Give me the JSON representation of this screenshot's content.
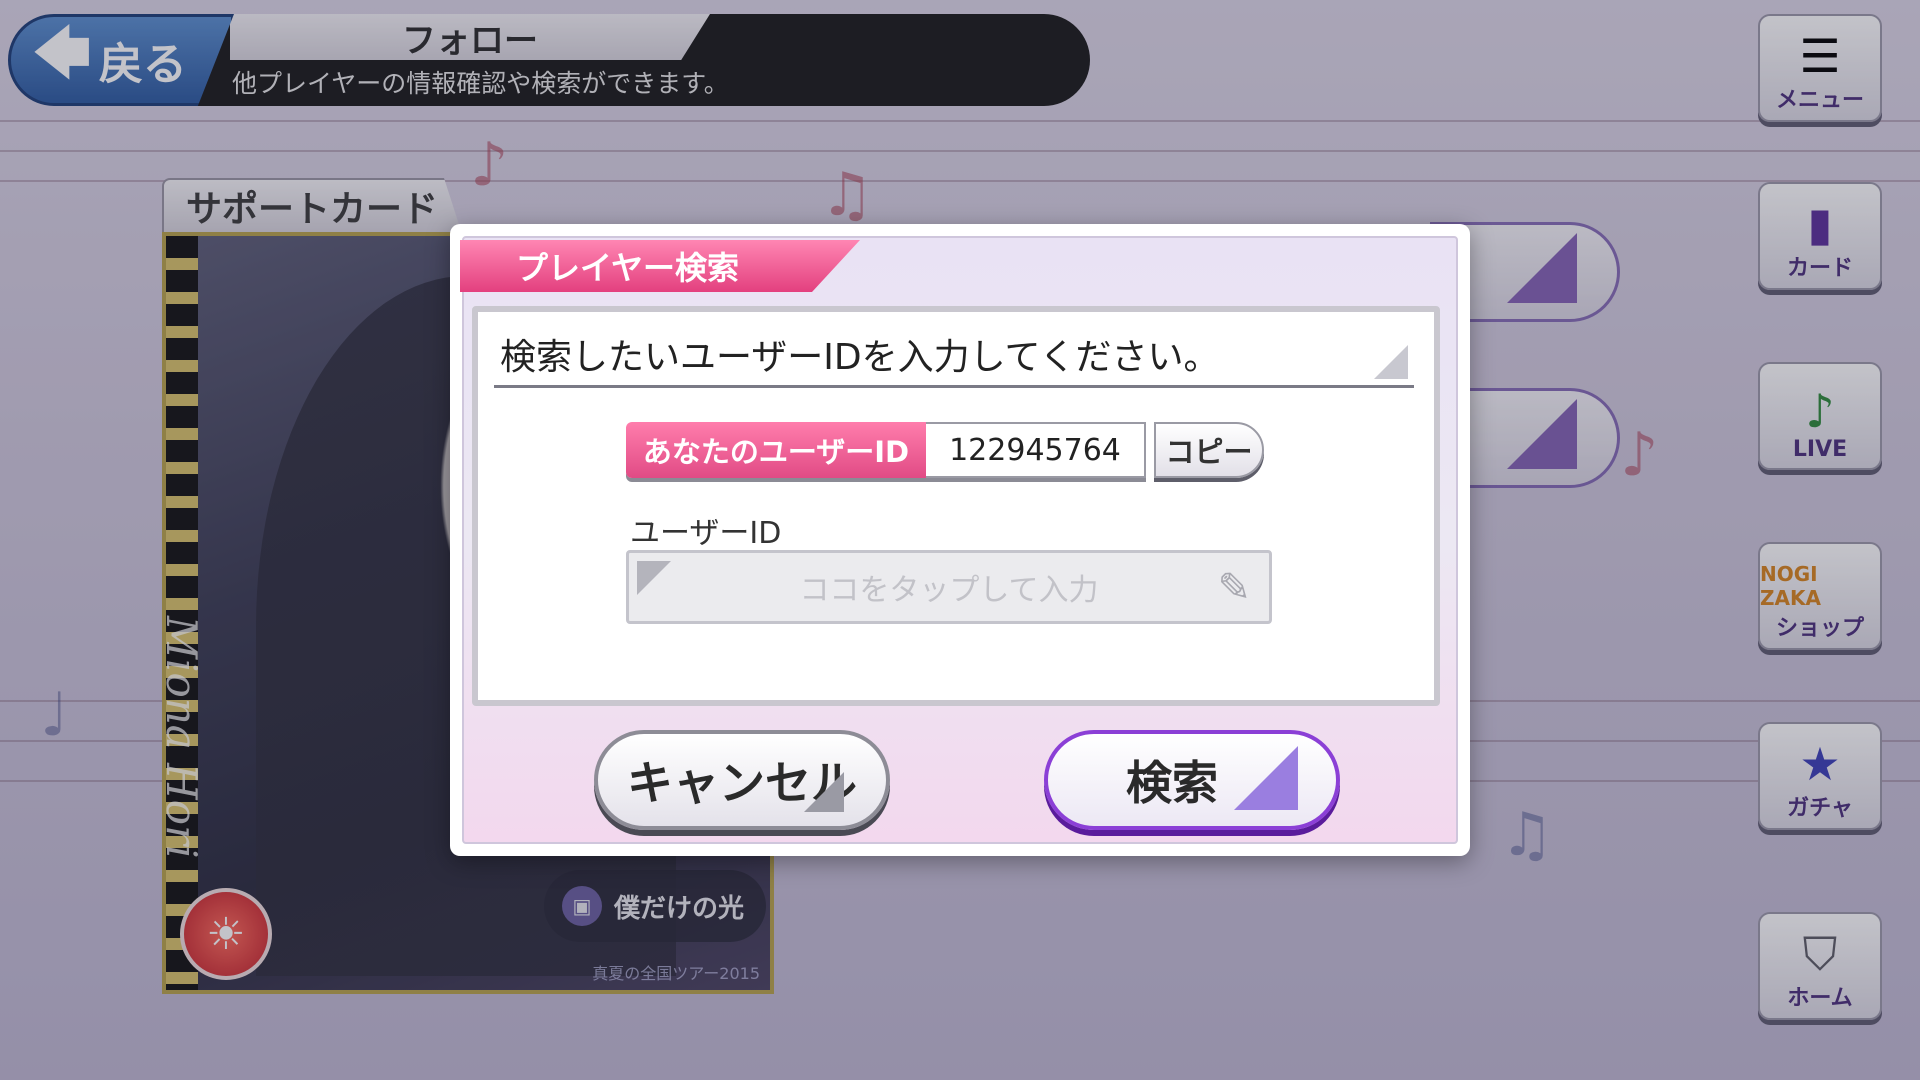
{
  "header": {
    "back_label": "戻る",
    "title": "フォロー",
    "subtitle": "他プレイヤーの情報確認や検索ができます。"
  },
  "side_menu": [
    {
      "label": "メニュー",
      "icon": "hamburger-icon"
    },
    {
      "label": "カード",
      "icon": "card-icon"
    },
    {
      "label": "LIVE",
      "icon": "music-note-icon"
    },
    {
      "label": "ショップ",
      "icon": "shopping-bag-icon",
      "sub": "NOGI ZAKA"
    },
    {
      "label": "ガチャ",
      "icon": "gacha-cards-icon"
    },
    {
      "label": "ホーム",
      "icon": "home-shield-icon"
    }
  ],
  "support_card": {
    "tab_label": "サポートカード",
    "name": "Miona Hori",
    "song": "僕だけの光",
    "caption": "真夏の全国ツアー2015"
  },
  "dialog": {
    "title": "プレイヤー検索",
    "prompt": "検索したいユーザーIDを入力してください。",
    "your_id_label": "あなたのユーザーID",
    "your_id_value": "122945764",
    "copy_label": "コピー",
    "field_label": "ユーザーID",
    "input_placeholder": "ココをタップして入力",
    "cancel_label": "キャンセル",
    "search_label": "検索"
  },
  "colors": {
    "accent_pink": "#e3407f",
    "accent_purple": "#8b3fd6",
    "header_black": "#1a1a1a",
    "back_blue": "#2c5aa0"
  }
}
